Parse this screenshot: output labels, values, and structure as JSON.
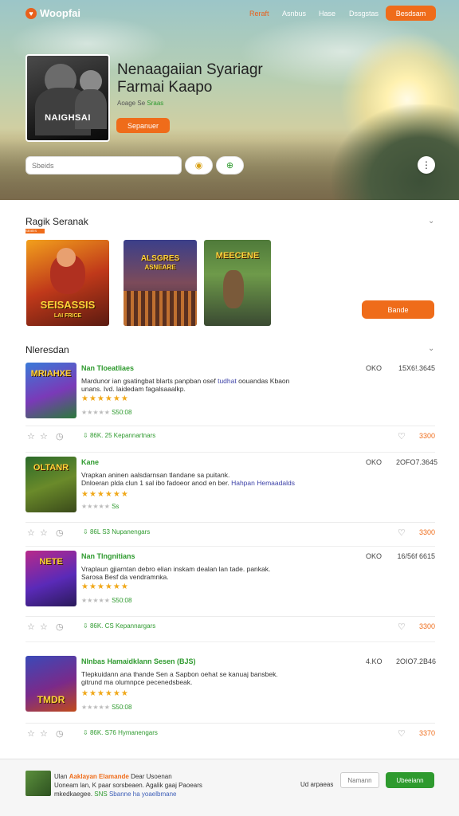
{
  "nav": {
    "brand": "Woopfai",
    "links": [
      "Reraft",
      "Asnbus",
      "Hase",
      "Dssgstas"
    ],
    "cta": "Besdsam"
  },
  "hero": {
    "cover_text": "NAIGHSAI",
    "title_line1": "Nenaagaiian Syariagr",
    "title_line2": "Farmai Kaapo",
    "meta_prefix": "Aoage Se",
    "meta_highlight": "Sraas",
    "button": "Sepanuer",
    "search_placeholder": "Sbeids"
  },
  "featured": {
    "title": "Ragik Seranak",
    "badge": "SEIIEIS",
    "tiles": [
      {
        "label_top": "SEISASSIS",
        "label_bottom": "LAI FRICE"
      },
      {
        "label_top": "ALSGRES",
        "label_bottom": "ASNEARE"
      },
      {
        "label_top": "MEECENE",
        "label_bottom": ""
      }
    ],
    "button": "Bande"
  },
  "list": {
    "title": "Nleresdan",
    "items": [
      {
        "thumb_text": "MRIAHXE",
        "name": "Nan Tloeatliaes",
        "desc1": "Mardunor ian gsatingbat blarts panpban osef",
        "desc_link": "tudhat",
        "desc1b": "oouandas Kbaon",
        "desc2": "unans. Ivd. laidedam fagalsaaalkp.",
        "rating_text": "S50:08",
        "size": "OKO",
        "date": "15X6!.3645",
        "downloads": "86K. 25",
        "publisher": "Kepannartnars",
        "price": "3300"
      },
      {
        "thumb_text": "OLTANR",
        "name": "Kane",
        "desc1": "Vrapkan aninen aalsdarnsan tlandane sa puitank.",
        "desc2": "Dnloeran plda clun 1 sal ibo fadoeor anod en ber.",
        "desc_link": "Hahpan Hemaadalds",
        "rating_text": "Ss",
        "size": "OKO",
        "date": "2OFO7.3645",
        "downloads": "86L S3",
        "publisher": "Nupanengars",
        "price": "3300"
      },
      {
        "thumb_text": "NETE",
        "name": "Nan Tlngnitians",
        "desc1": "Vraplaun gjiarntan debro elian inskam dealan lan tade. pankak.",
        "desc2": "Sarosa Besf da vendramnka.",
        "desc_link": "",
        "rating_text": "S50:08",
        "size": "OKO",
        "date": "16/56f 6615",
        "downloads": "86K. CS",
        "publisher": "Kepannargars",
        "price": "3300"
      },
      {
        "thumb_text": "TMDR",
        "name": "Nlnbas Hamaidklann Sesen (BJS)",
        "desc1": "Tlepkuidann ana thande Sen a Sapbon oehat se kanuaj bansbek.",
        "desc2": "gitrund ma olumnpce pecenedsbeak.",
        "desc_link": "",
        "rating_text": "S50:08",
        "size": "4.KO",
        "date": "2OIO7.2B46",
        "downloads": "86K. S76",
        "publisher": "Hymanengars",
        "price": "3370"
      }
    ]
  },
  "bottom": {
    "line1_prefix": "Ulan",
    "line1_highlight": "Aaklayan Elamande",
    "line1_suffix": "Dear Usoenan",
    "line2": "Uoneam lan, K paar sorsbeaen. Agalik gaaj Paoears",
    "line3_prefix": "mkedkaegee.",
    "line3_green": "SNS",
    "line3_blue": "Sbanne ha yoaelbmane",
    "label": "Ud arpaeas",
    "outline_btn": "Namann",
    "cta": "Ubeeiann"
  }
}
